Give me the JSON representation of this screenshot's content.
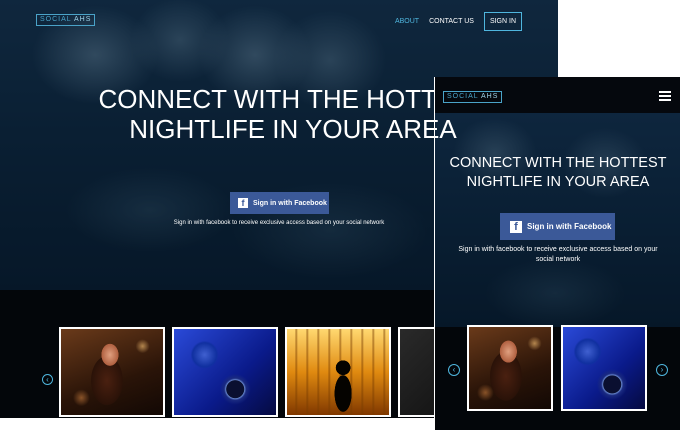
{
  "brand": {
    "part1": "SOCIAL",
    "part2": "AHS"
  },
  "nav": {
    "about": "ABOUT",
    "contact": "CONTACT US",
    "signin": "SIGN IN"
  },
  "hero": {
    "title": "CONNECT WITH THE HOTTEST NIGHTLIFE IN YOUR AREA",
    "button": "Sign in with Facebook",
    "subtitle": "Sign in with facebook to receive exclusive access based on your social network"
  },
  "icons": {
    "facebook": "facebook-icon",
    "prev": "chevron-left-icon",
    "next": "chevron-right-icon",
    "menu": "hamburger-icon"
  },
  "gallery": [
    "woman-with-drink",
    "dj-turntables",
    "bartender-bar",
    "party-photo"
  ],
  "colors": {
    "accent": "#4fb6de",
    "facebook": "#3b5998",
    "background": "#05080d"
  }
}
